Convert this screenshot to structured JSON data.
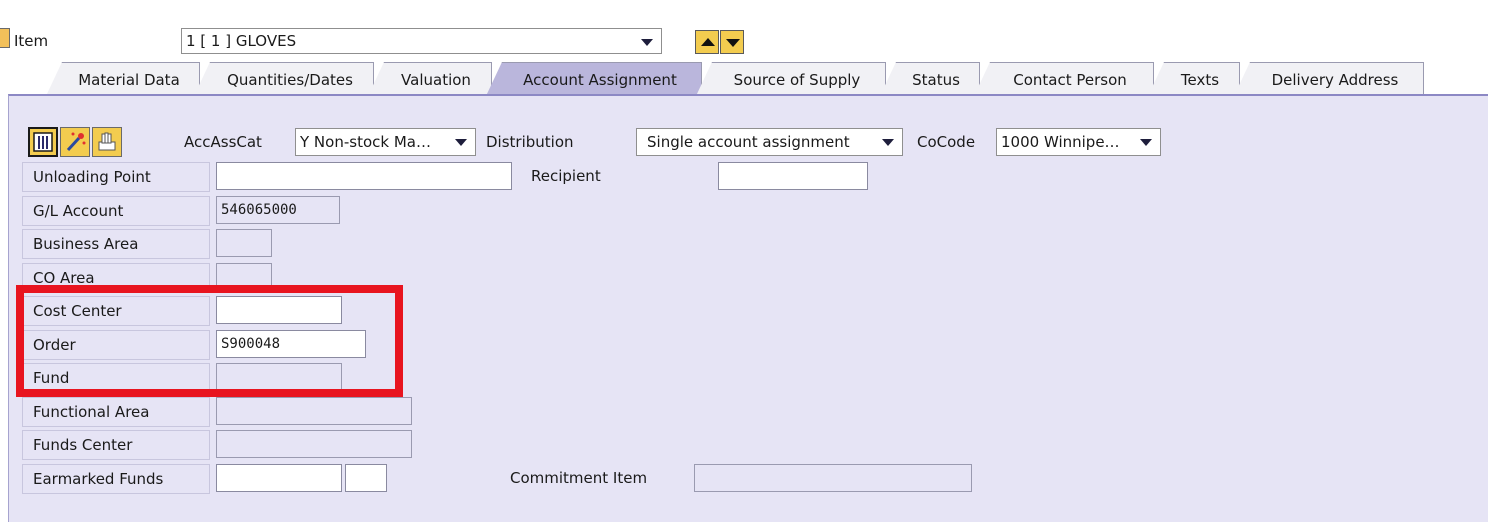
{
  "item": {
    "label": "Item",
    "selected": "1 [ 1 ] GLOVES"
  },
  "tabs": [
    {
      "label": "Material Data",
      "active": false
    },
    {
      "label": "Quantities/Dates",
      "active": false
    },
    {
      "label": "Valuation",
      "active": false
    },
    {
      "label": "Account Assignment",
      "active": true
    },
    {
      "label": "Source of Supply",
      "active": false
    },
    {
      "label": "Status",
      "active": false
    },
    {
      "label": "Contact Person",
      "active": false
    },
    {
      "label": "Texts",
      "active": false
    },
    {
      "label": "Delivery Address",
      "active": false
    }
  ],
  "toolbar": {
    "icons": [
      "grid-icon",
      "magic-wand-icon",
      "hand-icon"
    ]
  },
  "acc": {
    "acc_ass_cat_label": "AccAssCat",
    "acc_ass_cat_value": "Y Non-stock Ma…",
    "distribution_label": "Distribution",
    "distribution_value": "Single account assignment",
    "cocode_label": "CoCode",
    "cocode_value": "1000 Winnipe…"
  },
  "fields": {
    "unloading_point": {
      "label": "Unloading Point",
      "value": ""
    },
    "recipient": {
      "label": "Recipient",
      "value": ""
    },
    "gl_account": {
      "label": "G/L Account",
      "value": "546065000"
    },
    "business_area": {
      "label": "Business Area",
      "value": ""
    },
    "co_area": {
      "label": "CO Area",
      "value": ""
    },
    "cost_center": {
      "label": "Cost Center",
      "value": ""
    },
    "order": {
      "label": "Order",
      "value": "S900048"
    },
    "fund": {
      "label": "Fund",
      "value": ""
    },
    "functional_area": {
      "label": "Functional Area",
      "value": ""
    },
    "funds_center": {
      "label": "Funds Center",
      "value": ""
    },
    "earmarked_funds": {
      "label": "Earmarked Funds",
      "value": "",
      "item_value": ""
    },
    "commitment_item": {
      "label": "Commitment Item",
      "value": ""
    }
  },
  "colors": {
    "panel_bg": "#e6e4f5",
    "active_tab": "#bab6dc",
    "highlight_box": "#e8141f",
    "button_yellow": "#f3cc4f"
  }
}
